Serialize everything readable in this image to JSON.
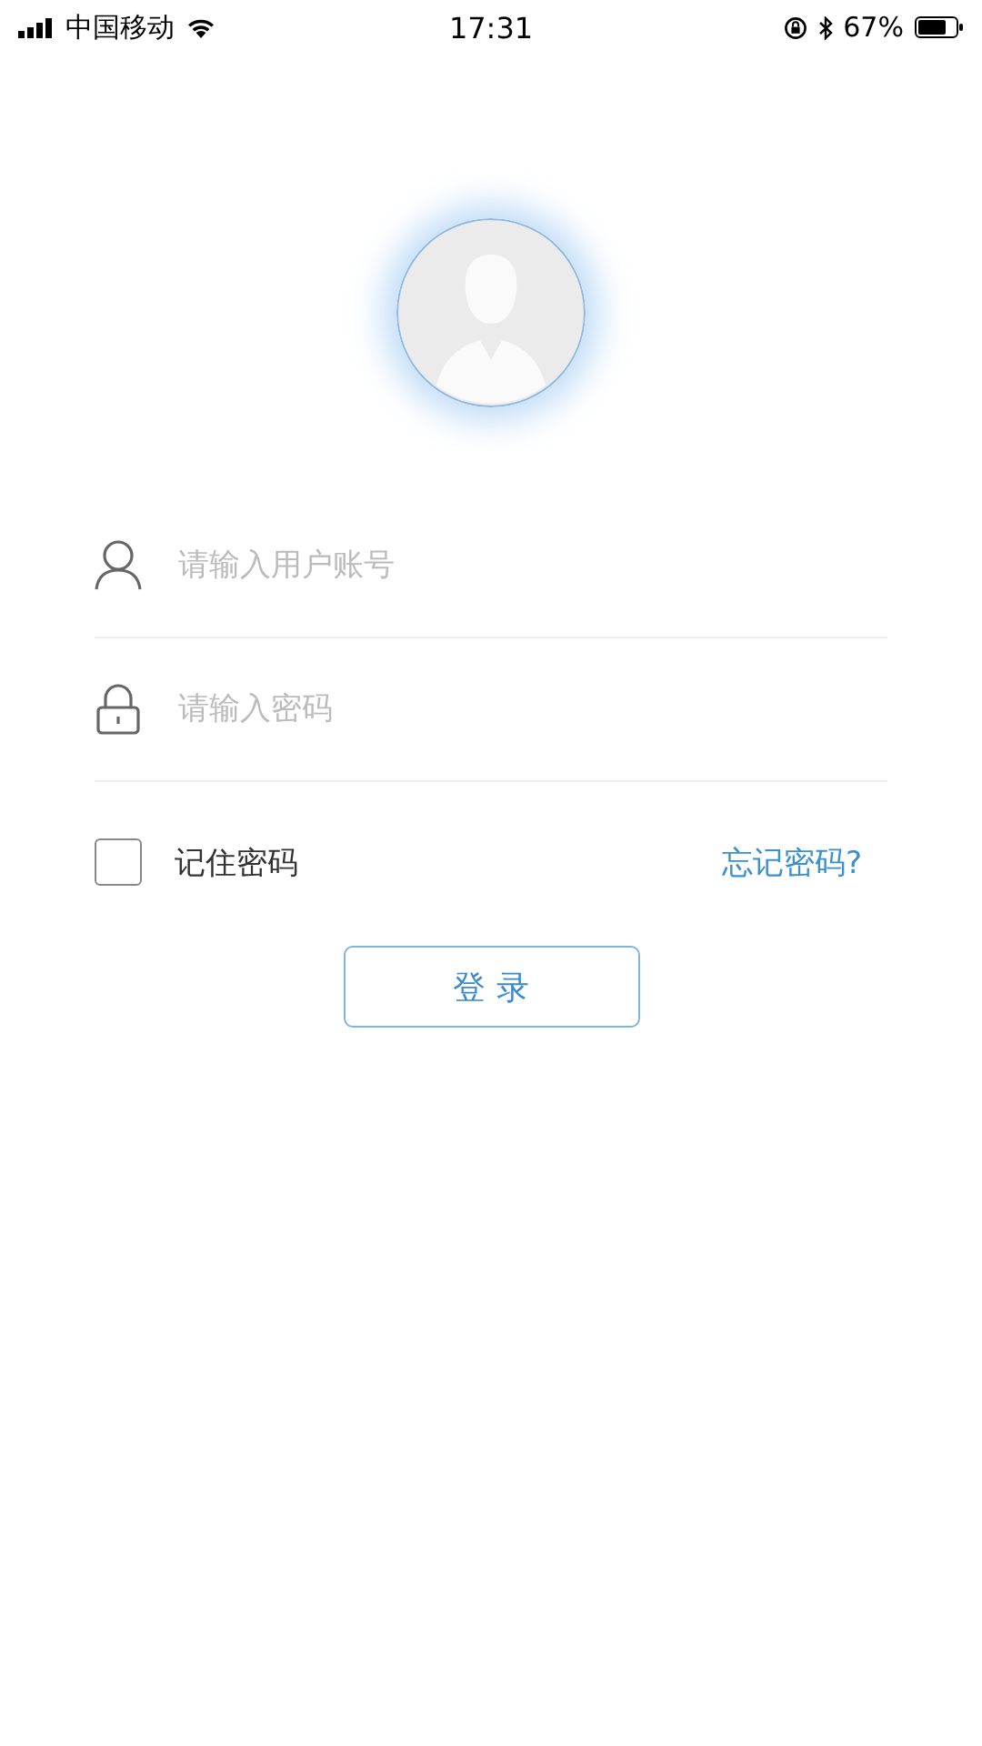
{
  "status_bar": {
    "carrier": "中国移动",
    "time": "17:31",
    "battery": "67%"
  },
  "login_form": {
    "fields": [
      {
        "kind": "user",
        "placeholder": "请输入用户账号"
      },
      {
        "kind": "password",
        "placeholder": "请输入密码"
      }
    ],
    "remember": {
      "label": "记住密码",
      "checked": false
    },
    "forgot_link": "忘记密码?",
    "login_button": "登 录"
  }
}
